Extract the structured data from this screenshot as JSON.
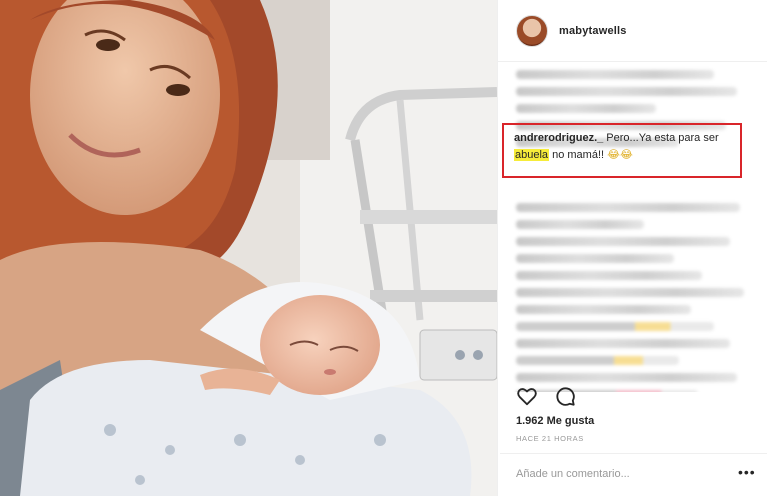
{
  "post": {
    "username": "mabytawells",
    "highlighted_comment": {
      "user": "andrerodriguez._",
      "text_before": " Pero...Ya esta para ser ",
      "highlighted_word": "abuela",
      "text_after": " no mamá!! ",
      "emoji": "😂😂"
    },
    "likes": "1.962 Me gusta",
    "time_ago": "HACE 21 HORAS",
    "comment_placeholder": "Añade un comentario...",
    "more_label": "•••"
  },
  "icons": {
    "like": "heart-icon",
    "comment": "comment-bubble-icon",
    "more": "more-options-icon"
  },
  "colors": {
    "highlight_box": "#d9252a",
    "highlight_marker": "#f6ec3a"
  }
}
